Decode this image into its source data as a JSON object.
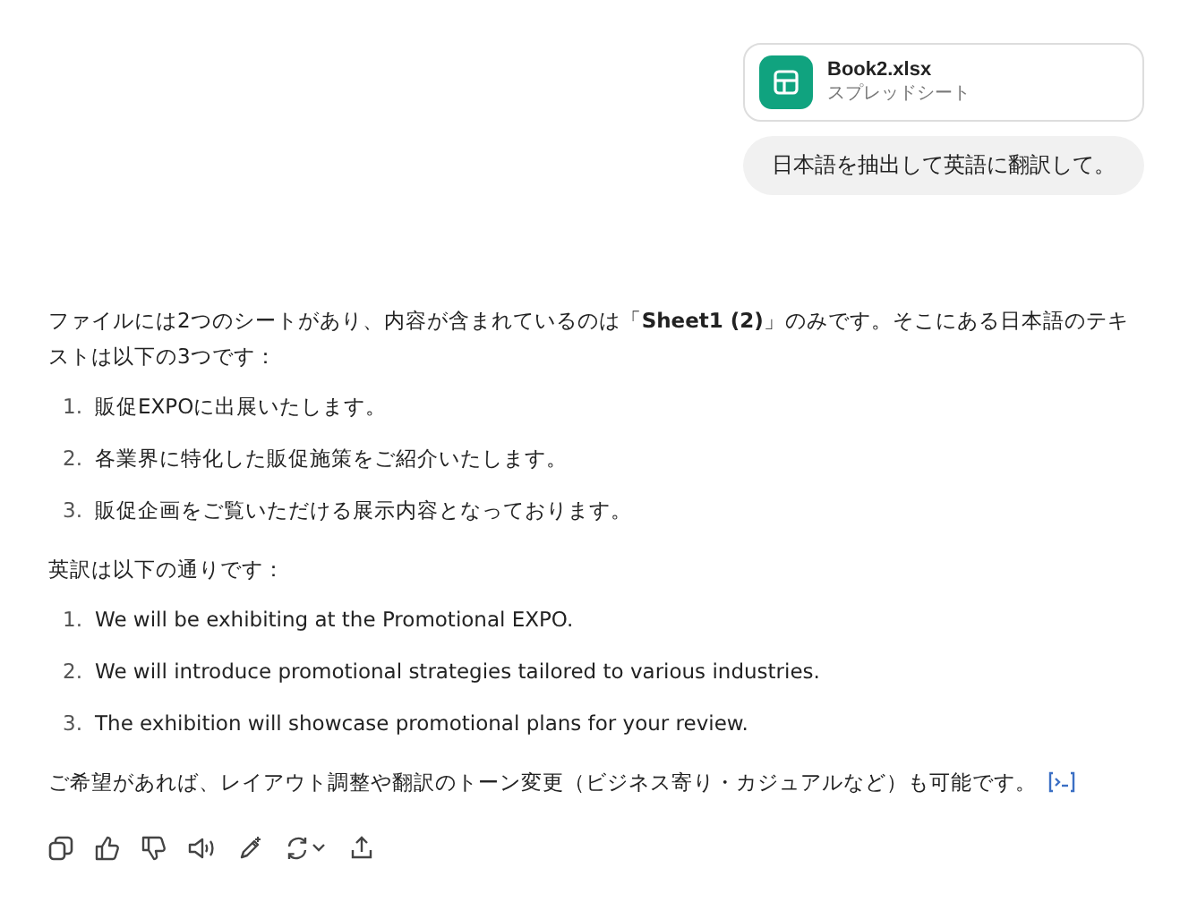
{
  "attachment": {
    "name": "Book2.xlsx",
    "type": "スプレッドシート"
  },
  "user_message": "日本語を抽出して英語に翻訳して。",
  "reply": {
    "intro": "ファイルには2つのシートがあり、内容が含まれているのは「**Sheet1 (2)**」のみです。そこにある日本語のテキストは以下の3つです：",
    "japanese_items": [
      {
        "number": "1.",
        "text": "販促EXPOに出展いたします。"
      },
      {
        "number": "2.",
        "text": "各業界に特化した販促施策をご紹介いたします。"
      },
      {
        "number": "3.",
        "text": "販促企画をご覧いただける展示内容となっております。"
      }
    ],
    "translation_heading": "英訳は以下の通りです：",
    "english_items": [
      {
        "number": "1.",
        "text": "We will be exhibiting at the Promotional EXPO."
      },
      {
        "number": "2.",
        "text": "We will introduce promotional strategies tailored to various industries."
      },
      {
        "number": "3.",
        "text": "The exhibition will showcase promotional plans for your review."
      }
    ],
    "closing": "ご希望があれば、レイアウト調整や翻訳のトーン変更（ビジネス寄り・カジュアルなど）も可能です。"
  },
  "actions": [
    {
      "kind": "copy"
    },
    {
      "kind": "like"
    },
    {
      "kind": "dislike"
    },
    {
      "kind": "read-aloud"
    },
    {
      "kind": "edit"
    },
    {
      "kind": "regenerate"
    },
    {
      "kind": "share"
    }
  ]
}
